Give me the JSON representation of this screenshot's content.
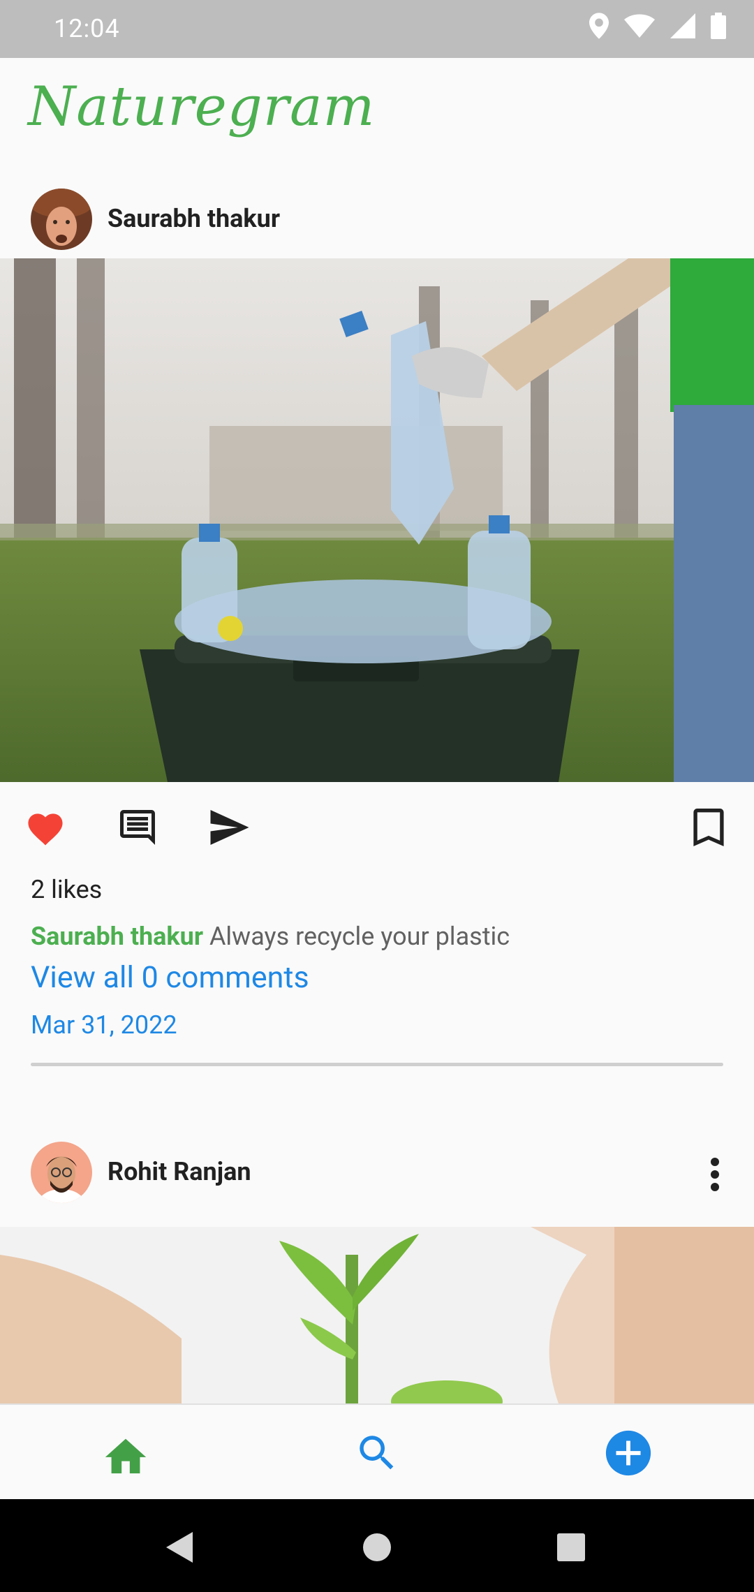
{
  "status_bar": {
    "time": "12:04"
  },
  "app": {
    "title": "Naturegram",
    "accent": "#4caf50",
    "link_color": "#1e88e5"
  },
  "posts": [
    {
      "username": "Saurabh thakur",
      "likes": "2 likes",
      "caption_author": "Saurabh thakur",
      "caption_text": " Always recycle your plastic",
      "comments_link": "View all 0 comments",
      "date": "Mar 31, 2022",
      "liked": true
    },
    {
      "username": "Rohit Ranjan"
    }
  ],
  "icons": {
    "like": "heart-icon",
    "comment": "comment-icon",
    "share": "send-icon",
    "save": "bookmark-icon",
    "more": "more-vert-icon",
    "nav_home": "home-icon",
    "nav_search": "search-icon",
    "nav_add": "add-circle-icon"
  }
}
